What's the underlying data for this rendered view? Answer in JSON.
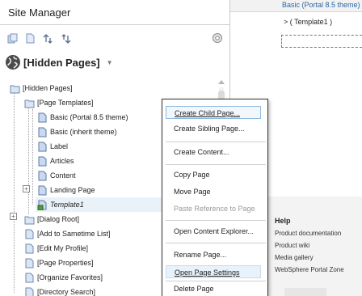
{
  "panel": {
    "title": "Site Manager",
    "space_selector": {
      "label": "[Hidden Pages]"
    }
  },
  "toolbar": {
    "buttons": [
      "pages-icon",
      "page-icon",
      "move-up-icon",
      "move-down-icon"
    ],
    "right_button": "settings-icon"
  },
  "tree": {
    "nodes": [
      {
        "label": "[Hidden Pages]",
        "icon": "folder-icon"
      },
      {
        "label": "[Page Templates]",
        "icon": "folder-icon"
      },
      {
        "label": "Basic (Portal 8.5 theme)",
        "icon": "page-icon"
      },
      {
        "label": "Basic (inherit theme)",
        "icon": "page-icon"
      },
      {
        "label": "Label",
        "icon": "page-icon"
      },
      {
        "label": "Articles",
        "icon": "page-icon"
      },
      {
        "label": "Content",
        "icon": "page-icon"
      },
      {
        "label": "Landing Page",
        "icon": "page-icon"
      },
      {
        "label": "Template1",
        "icon": "template-page-icon",
        "selected": true
      },
      {
        "label": "[Dialog Root]",
        "icon": "folder-icon"
      },
      {
        "label": "[Add to Sametime List]",
        "icon": "page-icon"
      },
      {
        "label": "[Edit My Profile]",
        "icon": "page-icon"
      },
      {
        "label": "[Page Properties]",
        "icon": "page-icon"
      },
      {
        "label": "[Organize Favorites]",
        "icon": "page-icon"
      },
      {
        "label": "[Directory Search]",
        "icon": "page-icon"
      }
    ]
  },
  "context_menu": {
    "items": [
      {
        "label": "Create Child Page...",
        "state": "focused"
      },
      {
        "label": "Create Sibling Page...",
        "state": "normal"
      },
      {
        "label": "Create Content...",
        "state": "normal"
      },
      {
        "label": "Copy Page",
        "state": "normal"
      },
      {
        "label": "Move Page",
        "state": "normal"
      },
      {
        "label": "Paste Reference to Page",
        "state": "disabled"
      },
      {
        "label": "Open Content Explorer...",
        "state": "normal"
      },
      {
        "label": "Rename Page...",
        "state": "normal"
      },
      {
        "label": "Open Page Settings",
        "state": "hovered"
      },
      {
        "label": "Delete Page",
        "state": "normal"
      }
    ]
  },
  "right_pane": {
    "tab_text": "Basic (Portal 8.5 theme)",
    "breadcrumb": ">  ( Template1 )",
    "help": {
      "title": "Help",
      "links": [
        "Product documentation",
        "Product wiki",
        "Media gallery",
        "WebSphere Portal Zone"
      ]
    }
  },
  "colors": {
    "link": "#2a66a8",
    "selected_row": "#eaf2f9",
    "menu_focus_border": "#8fb9e0",
    "footer_band": "#f3f3f3"
  }
}
